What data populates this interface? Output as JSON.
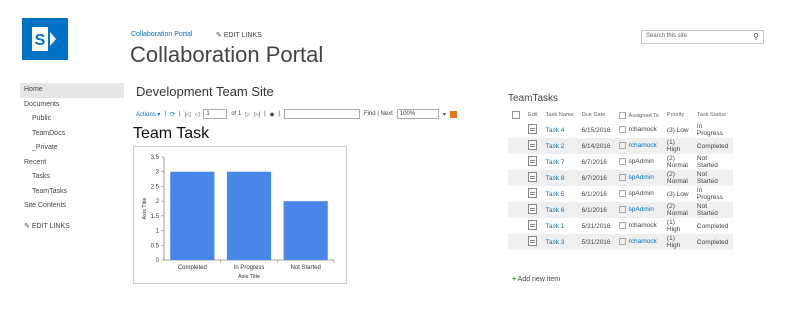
{
  "header": {
    "breadcrumb": "Collaboration Portal",
    "edit_links": "EDIT LINKS",
    "site_title": "Collaboration Portal",
    "search_placeholder": "Search this site"
  },
  "nav": {
    "items": [
      {
        "label": "Home"
      },
      {
        "label": "Documents"
      },
      {
        "label": "Public"
      },
      {
        "label": "TeamDocs"
      },
      {
        "label": "_Private"
      },
      {
        "label": "Recent"
      },
      {
        "label": "Tasks"
      },
      {
        "label": "TeamTasks"
      },
      {
        "label": "Site Contents"
      }
    ],
    "edit_links": "EDIT LINKS"
  },
  "main": {
    "page_title": "Development Team Site",
    "toolbar": {
      "actions": "Actions ▾",
      "page_value": "1",
      "page_of": "of 1",
      "find_next": "Find | Next",
      "zoom": "100%"
    }
  },
  "chart_data": {
    "type": "bar",
    "title": "Team Task",
    "categories": [
      "Completed",
      "In Progress",
      "Not Started"
    ],
    "values": [
      3,
      3,
      2
    ],
    "xlabel": "Axis Title",
    "ylabel": "Axis Title",
    "ylim": [
      0,
      3.5
    ],
    "yticks": [
      "0",
      "0.5",
      "1",
      "1.5",
      "2",
      "2.5",
      "3",
      "3.5"
    ],
    "bar_color": "#4a86e8",
    "grid": false
  },
  "teamtasks": {
    "title": "TeamTasks",
    "headers": [
      "Edit",
      "Task Name",
      "Due Date",
      "Assigned To",
      "Priority",
      "Task Status"
    ],
    "rows": [
      {
        "name": "Task 4",
        "due": "6/15/2016",
        "assigned": "rchamock",
        "priority": "(3) Low",
        "status": "In Progress"
      },
      {
        "name": "Task 2",
        "due": "6/14/2016",
        "assigned": "rchamock",
        "priority": "(1) High",
        "status": "Completed"
      },
      {
        "name": "Task 7",
        "due": "6/7/2016",
        "assigned": "spAdmin",
        "priority": "(2) Normal",
        "status": "Not Started"
      },
      {
        "name": "Task 8",
        "due": "6/7/2016",
        "assigned": "spAdmin",
        "priority": "(2) Normal",
        "status": "Not Started"
      },
      {
        "name": "Task 5",
        "due": "6/1/2016",
        "assigned": "spAdmin",
        "priority": "(3) Low",
        "status": "In Progress"
      },
      {
        "name": "Task 6",
        "due": "6/1/2016",
        "assigned": "spAdmin",
        "priority": "(2) Normal",
        "status": "Not Started"
      },
      {
        "name": "Task 1",
        "due": "5/31/2016",
        "assigned": "rchamock",
        "priority": "(1) High",
        "status": "Completed"
      },
      {
        "name": "Task 3",
        "due": "5/31/2016",
        "assigned": "rchamock",
        "priority": "(1) High",
        "status": "Completed"
      }
    ],
    "add_new": "Add new item"
  },
  "colors": {
    "accent": "#0072c6",
    "logo": "#0072c6"
  }
}
